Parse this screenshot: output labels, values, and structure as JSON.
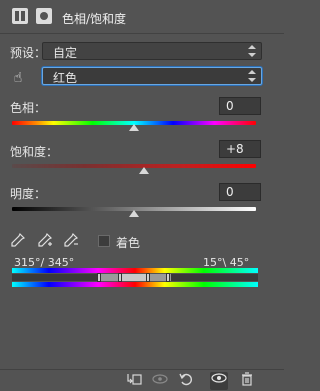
{
  "header": {
    "adjust_icon": "hue-saturation-adjustment-icon",
    "mask_icon": "layer-mask-icon",
    "title": "色相/饱和度"
  },
  "preset": {
    "label": "预设：",
    "value": "自定"
  },
  "channel": {
    "icon": "target-adjust-hand-icon",
    "value": "红色"
  },
  "hue": {
    "label": "色相：",
    "value": "0",
    "level": 0.5
  },
  "saturation": {
    "label": "饱和度：",
    "value": "+8",
    "level": 0.54
  },
  "lightness": {
    "label": "明度：",
    "value": "0",
    "level": 0.5
  },
  "eyedroppers": [
    "eyedropper-icon",
    "eyedropper-plus-icon",
    "eyedropper-minus-icon"
  ],
  "colorize": {
    "label": "着色",
    "checked": false
  },
  "range": {
    "left_text": "315°/ 345°",
    "right_text": "15°\\ 45°"
  },
  "toolbar": {
    "items": [
      "clip-to-layer-icon",
      "view-previous-state-icon",
      "reset-icon",
      "visibility-eye-icon",
      "delete-icon"
    ]
  }
}
